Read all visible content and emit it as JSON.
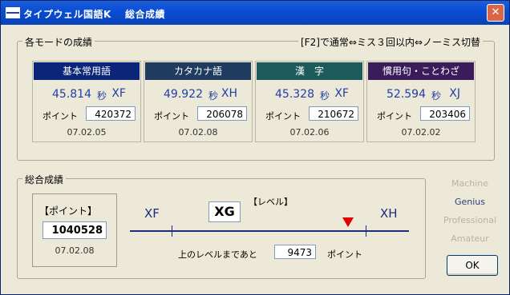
{
  "window": {
    "title": "タイプウェル国語K　 総合成績",
    "close_glyph": "✕"
  },
  "modes_group": {
    "label": "各モードの成績",
    "hint": "[F2]で通常⇔ミス３回以内⇔ノーミス切替"
  },
  "modes": [
    {
      "name": "基本常用語",
      "time": "45.814",
      "unit": "秒",
      "rank": "XF",
      "point_label": "ポイント",
      "points": "420372",
      "date": "07.02.05",
      "color": "#0B2579"
    },
    {
      "name": "カタカナ語",
      "time": "49.922",
      "unit": "秒",
      "rank": "XH",
      "point_label": "ポイント",
      "points": "206078",
      "date": "07.02.08",
      "color": "#1F3C5E"
    },
    {
      "name": "漢　字",
      "time": "45.328",
      "unit": "秒",
      "rank": "XF",
      "point_label": "ポイント",
      "points": "210672",
      "date": "07.02.06",
      "color": "#1D5A5A"
    },
    {
      "name": "慣用句・ことわざ",
      "time": "52.594",
      "unit": "秒",
      "rank": "XJ",
      "point_label": "ポイント",
      "points": "203406",
      "date": "07.02.02",
      "color": "#3A1C5A"
    }
  ],
  "overall": {
    "label": "総合成績",
    "point_title": "【ポイント】",
    "points": "1040528",
    "date": "07.02.08",
    "level_title": "【レベル】",
    "level": "XG",
    "left_mark": "XF",
    "right_mark": "XH",
    "remaining_label": "上のレベルまであと",
    "remaining": "9473",
    "remaining_unit": "ポイント",
    "progress_fraction": 0.91,
    "accent_color": "#E00000",
    "line_color": "#1C2C7A"
  },
  "level_options": [
    {
      "label": "Machine",
      "active": false
    },
    {
      "label": "Genius",
      "active": true
    },
    {
      "label": "Professional",
      "active": false
    },
    {
      "label": "Amateur",
      "active": false
    }
  ],
  "ok_label": "OK"
}
